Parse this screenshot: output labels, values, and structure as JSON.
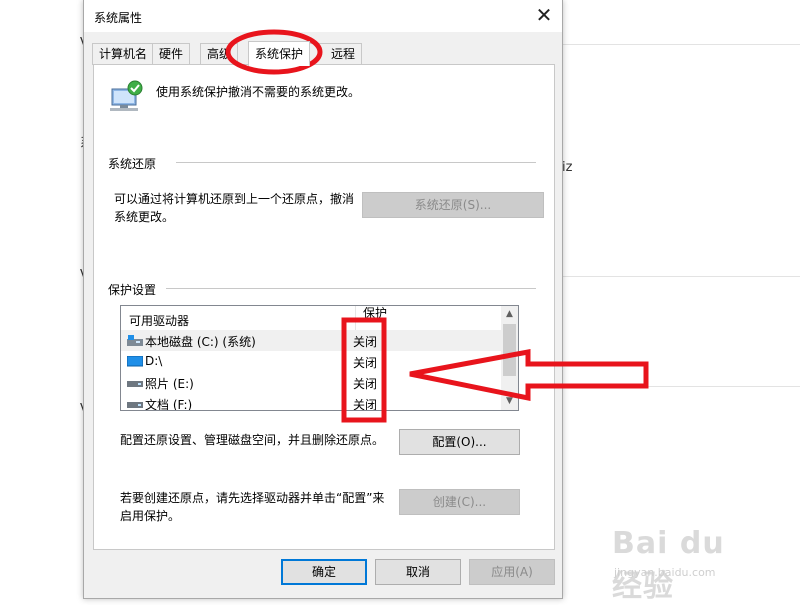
{
  "background": {
    "fragments": [
      "V",
      "系",
      "V",
      "iz",
      "V"
    ]
  },
  "dialog": {
    "title": "系统属性",
    "close_glyph": "✕",
    "tabs": [
      "计算机名",
      "硬件",
      "高级",
      "系统保护",
      "远程"
    ],
    "active_tab": "系统保护",
    "description": "使用系统保护撤消不需要的系统更改。",
    "restore_section": {
      "title": "系统还原",
      "text": "可以通过将计算机还原到上一个还原点，撤消系统更改。",
      "button": "系统还原(S)..."
    },
    "protection_section": {
      "title": "保护设置",
      "columns": [
        "可用驱动器",
        "保护"
      ],
      "drives": [
        {
          "name": "本地磁盘 (C:) (系统)",
          "state": "关闭",
          "icon": "system-drive-icon"
        },
        {
          "name": "D:\\",
          "state": "关闭",
          "icon": "monitor-drive-icon"
        },
        {
          "name": "照片 (E:)",
          "state": "关闭",
          "icon": "drive-icon"
        },
        {
          "name": "文档 (F:)",
          "state": "关闭",
          "icon": "drive-icon"
        }
      ],
      "config_text": "配置还原设置、管理磁盘空间，并且删除还原点。",
      "config_button": "配置(O)...",
      "create_text": "若要创建还原点，请先选择驱动器并单击“配置”来启用保护。",
      "create_button": "创建(C)..."
    },
    "footer": {
      "ok": "确定",
      "cancel": "取消",
      "apply": "应用(A)"
    }
  },
  "colors": {
    "annotation_red": "#e8141c",
    "accent_blue": "#0078d7"
  },
  "watermark": {
    "main": "Bai du 经验",
    "sub": "jingyan.baidu.com"
  }
}
